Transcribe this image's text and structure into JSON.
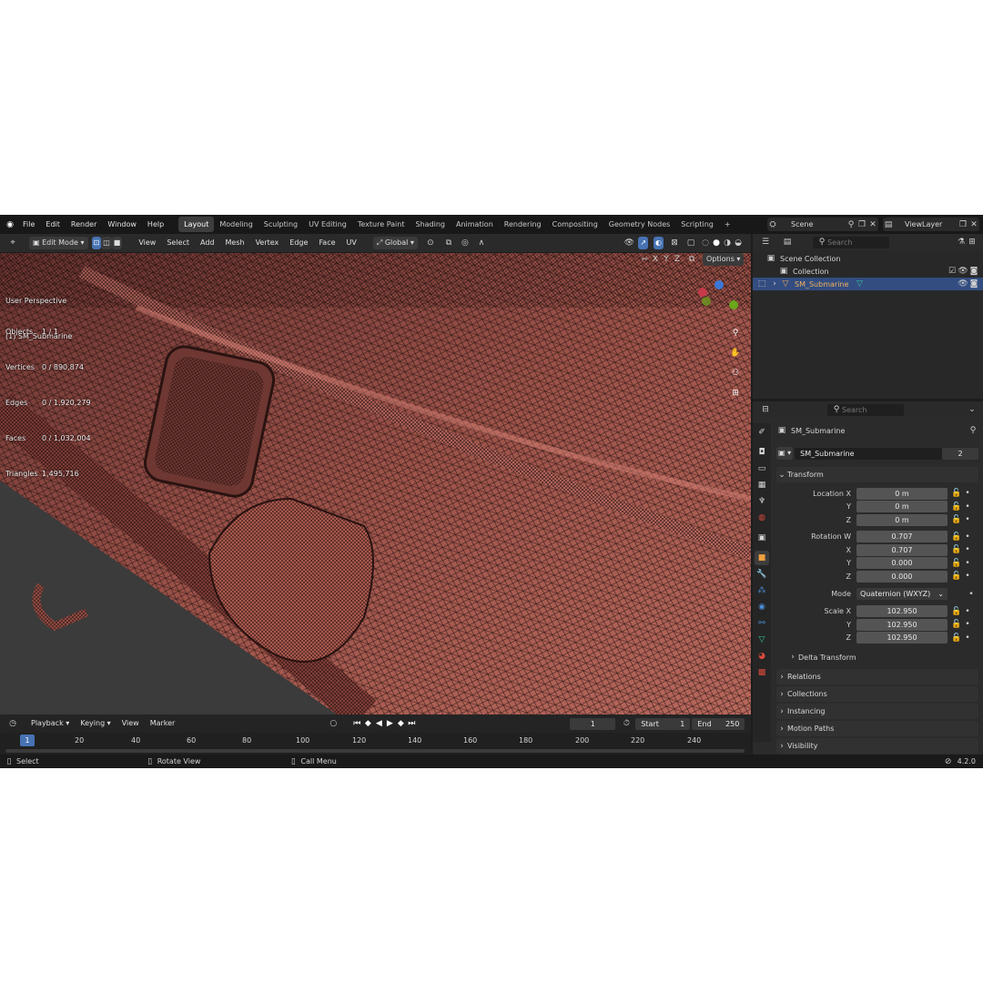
{
  "topbar": {
    "menus": [
      "File",
      "Edit",
      "Render",
      "Window",
      "Help"
    ],
    "workspaces": [
      "Layout",
      "Modeling",
      "Sculpting",
      "UV Editing",
      "Texture Paint",
      "Shading",
      "Animation",
      "Rendering",
      "Compositing",
      "Geometry Nodes",
      "Scripting"
    ],
    "active_workspace": "Layout",
    "add_tab": "+",
    "scene_label": "Scene",
    "viewlayer_label": "ViewLayer"
  },
  "viewport_header": {
    "mode": "Edit Mode",
    "menus": [
      "View",
      "Select",
      "Add",
      "Mesh",
      "Vertex",
      "Edge",
      "Face",
      "UV"
    ],
    "orientation": "Global",
    "options": "Options",
    "axes": [
      "X",
      "Y",
      "Z"
    ]
  },
  "overlay": {
    "perspective": "User Perspective",
    "object_name": "(1) SM_Submarine",
    "stats": [
      {
        "label": "Objects",
        "value": "1 / 1"
      },
      {
        "label": "Vertices",
        "value": "0 / 890,874"
      },
      {
        "label": "Edges",
        "value": "0 / 1,920,279"
      },
      {
        "label": "Faces",
        "value": "0 / 1,032,004"
      },
      {
        "label": "Triangles",
        "value": "1,495,716"
      }
    ],
    "gizmo_colors": {
      "x": "#c7394b",
      "y": "#6ba71a",
      "z": "#3c78d8"
    }
  },
  "timeline": {
    "menus": [
      "Playback",
      "Keying",
      "View",
      "Marker"
    ],
    "current_frame": "1",
    "start_label": "Start",
    "start": "1",
    "end_label": "End",
    "end": "250",
    "ticks": [
      "1",
      "20",
      "40",
      "60",
      "80",
      "100",
      "120",
      "140",
      "160",
      "180",
      "200",
      "220",
      "240"
    ]
  },
  "status": {
    "select": "Select",
    "rotate": "Rotate View",
    "call_menu": "Call Menu",
    "version": "4.2.0"
  },
  "outliner": {
    "search_placeholder": "Search",
    "scene_collection": "Scene Collection",
    "collection": "Collection",
    "object": "SM_Submarine"
  },
  "properties": {
    "search_placeholder": "Search",
    "object_name": "SM_Submarine",
    "data_name": "SM_Submarine",
    "users": "2",
    "transform_title": "Transform",
    "location": {
      "label": "Location X",
      "x": "0 m",
      "y": "0 m",
      "z": "0 m"
    },
    "rotation": {
      "label": "Rotation W",
      "w": "0.707",
      "x": "0.707",
      "y": "0.000",
      "z": "0.000"
    },
    "mode_label": "Mode",
    "mode_value": "Quaternion (WXYZ)",
    "scale": {
      "label": "Scale X",
      "x": "102.950",
      "y": "102.950",
      "z": "102.950"
    },
    "axis_y": "Y",
    "axis_z": "Z",
    "axis_x": "X",
    "delta_transform": "Delta Transform",
    "panels": [
      "Relations",
      "Collections",
      "Instancing",
      "Motion Paths",
      "Visibility"
    ]
  },
  "colors": {
    "accent": "#4772b3",
    "mesh": "#a85a4f",
    "selected_row": "#334d80"
  }
}
